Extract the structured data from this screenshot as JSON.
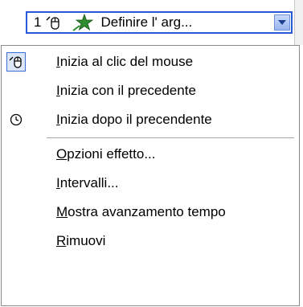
{
  "item_bar": {
    "number": "1",
    "name": "Definire l'    arg...",
    "mouse_icon": "mouse-icon",
    "effect_icon": "star-effect-icon",
    "dropdown_icon": "dropdown-arrow-icon",
    "border_color": "#2a5bd7"
  },
  "menu": {
    "items": [
      {
        "label_u": "I",
        "label_rest": "nizia al clic del mouse",
        "icon": "mouse-click-icon",
        "checked": true
      },
      {
        "label_u": "I",
        "label_rest": "nizia con il precedente",
        "icon": "",
        "checked": false
      },
      {
        "label_u": "I",
        "label_rest": "nizia dopo il precendente",
        "icon": "clock-icon",
        "checked": false
      },
      {
        "label_u": "O",
        "label_rest": "pzioni effetto...",
        "icon": "",
        "checked": false
      },
      {
        "label_u": "I",
        "label_rest": "ntervalli...",
        "icon": "",
        "checked": false
      },
      {
        "label_u": "M",
        "label_rest": "ostra avanzamento tempo",
        "icon": "",
        "checked": false
      },
      {
        "label_u": "R",
        "label_rest": "imuovi",
        "icon": "",
        "checked": false
      }
    ]
  }
}
